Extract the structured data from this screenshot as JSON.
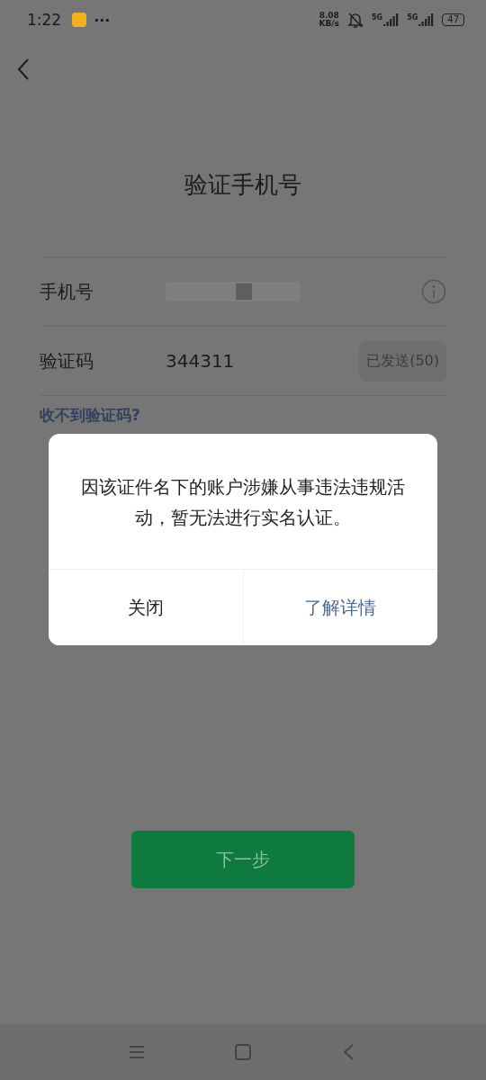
{
  "status_bar": {
    "time": "1:22",
    "more": "···",
    "speed_value": "8.08",
    "speed_unit": "KB/s",
    "sim_labels": [
      "5G",
      "5G"
    ],
    "battery": "47"
  },
  "title": "验证手机号",
  "form": {
    "phone_label": "手机号",
    "code_label": "验证码",
    "code_value": "344311",
    "send_button": {
      "label": "已发送(50)",
      "disabled": true
    },
    "help_link": "收不到验证码?"
  },
  "next_button": "下一步",
  "dialog": {
    "message": "因该证件名下的账户涉嫌从事违法违规活动，暂无法进行实名认证。",
    "buttons": [
      {
        "label": "关闭",
        "kind": "plain"
      },
      {
        "label": "了解详情",
        "kind": "link"
      }
    ]
  }
}
